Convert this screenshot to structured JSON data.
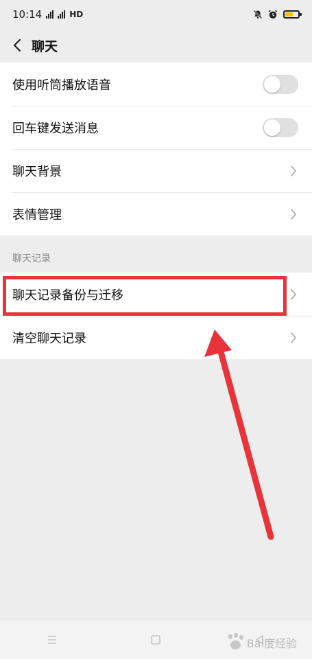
{
  "status_bar": {
    "time": "10:14",
    "network": "HD",
    "battery_color": "#f2c400",
    "battery_level": 0.55
  },
  "header": {
    "title": "聊天",
    "back_icon": "chevron-left-icon"
  },
  "settings": {
    "group1": [
      {
        "label": "使用听筒播放语音",
        "control": "toggle",
        "on": false
      },
      {
        "label": "回车键发送消息",
        "control": "toggle",
        "on": false
      },
      {
        "label": "聊天背景",
        "control": "chevron"
      },
      {
        "label": "表情管理",
        "control": "chevron"
      }
    ],
    "section_title": "聊天记录",
    "group2": [
      {
        "label": "聊天记录备份与迁移",
        "control": "chevron",
        "highlighted": true
      },
      {
        "label": "清空聊天记录",
        "control": "chevron"
      }
    ]
  },
  "annotation": {
    "color": "#e8333a"
  },
  "nav_bar": {
    "icons": [
      "menu-icon",
      "home-icon",
      "back-icon"
    ]
  },
  "watermark": {
    "text": "Bai度经验"
  }
}
